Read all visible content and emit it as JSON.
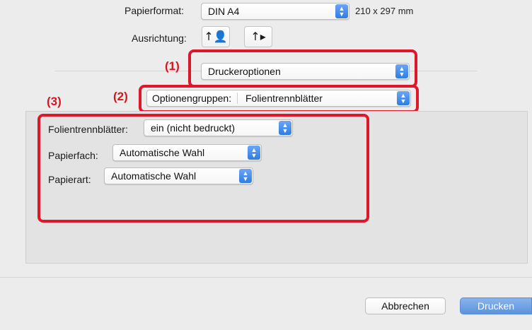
{
  "paper": {
    "label": "Papierformat:",
    "value": "DIN A4",
    "size": "210 x 297 mm"
  },
  "orientation": {
    "label": "Ausrichtung:",
    "portrait_glyph": "↑👤",
    "landscape_glyph": "↑▸"
  },
  "callouts": {
    "c1": "(1)",
    "c2": "(2)",
    "c3": "(3)"
  },
  "panel_menu": {
    "value": "Druckeroptionen"
  },
  "option_groups": {
    "label": "Optionengruppen:",
    "value": "Folientrennblätter"
  },
  "options": {
    "transparency": {
      "label": "Folientrennblätter:",
      "value": "ein (nicht bedruckt)"
    },
    "paper_tray": {
      "label": "Papierfach:",
      "value": "Automatische Wahl"
    },
    "paper_type": {
      "label": "Papierart:",
      "value": "Automatische Wahl"
    }
  },
  "buttons": {
    "cancel": "Abbrechen",
    "print": "Drucken"
  },
  "colors": {
    "accent": "#2f7de1",
    "highlight_red": "#e0162b",
    "print_button": "#6a9fe0"
  }
}
